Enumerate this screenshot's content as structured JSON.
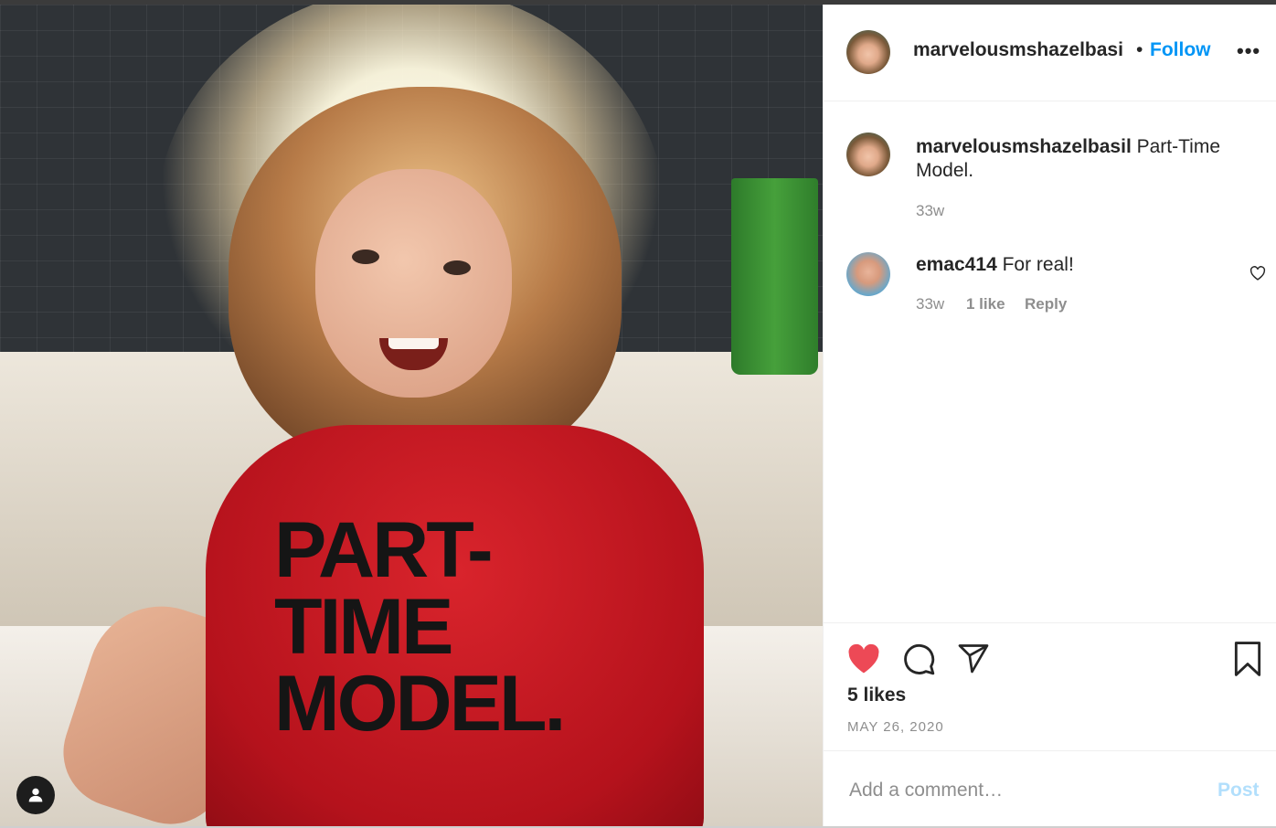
{
  "post": {
    "author": "marvelousmshazelbasi",
    "follow_label": "Follow",
    "more_label": "•••",
    "separator": "•",
    "caption_user": "marvelousmshazelbasil",
    "caption_text": "Part-Time Model.",
    "caption_age": "33w",
    "photo_shirt_text": "PART-\nTIME\nMODEL."
  },
  "comments": [
    {
      "user": "emac414",
      "text": "For real!",
      "age": "33w",
      "likes": "1 like",
      "reply_label": "Reply"
    }
  ],
  "stats": {
    "likes": "5 likes",
    "date": "MAY 26, 2020"
  },
  "comment_box": {
    "placeholder": "Add a comment…",
    "post_label": "Post"
  },
  "icons": {
    "like": "heart-filled-icon",
    "comment": "comment-bubble-icon",
    "share": "paper-plane-icon",
    "save": "bookmark-icon",
    "user_tag": "user-tag-icon"
  },
  "colors": {
    "like_red": "#ed4956",
    "follow_blue": "#0095f6",
    "post_disabled": "#b2dffc"
  }
}
